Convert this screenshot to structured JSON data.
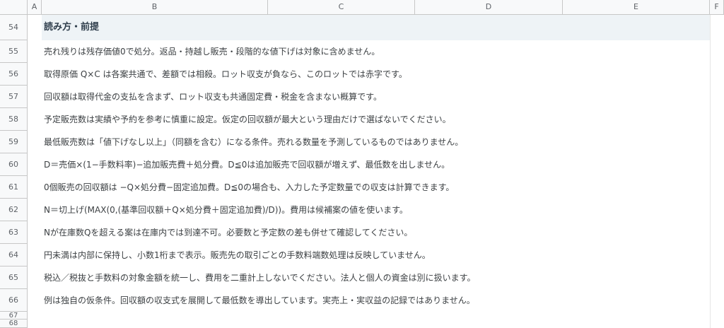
{
  "columns": [
    "A",
    "B",
    "C",
    "D",
    "E",
    "F"
  ],
  "rows": [
    {
      "num": "54",
      "text": "読み方・前提",
      "title": true
    },
    {
      "num": "55",
      "text": "売れ残りは残存価値0で処分。返品・持越し販売・段階的な値下げは対象に含めません。"
    },
    {
      "num": "56",
      "text": "取得原価 Q×C は各案共通で、差額では相殺。ロット収支が負なら、このロットでは赤字です。"
    },
    {
      "num": "57",
      "text": "回収額は取得代金の支払を含まず、ロット収支も共通固定費・税金を含まない概算です。"
    },
    {
      "num": "58",
      "text": "予定販売数は実績や予約を参考に慎重に設定。仮定の回収額が最大という理由だけで選ばないでください。"
    },
    {
      "num": "59",
      "text": "最低販売数は「値下げなし以上」（同額を含む）になる条件。売れる数量を予測しているものではありません。"
    },
    {
      "num": "60",
      "text": "D＝売価×(1−手数料率)−追加販売費＋処分費。D≦0は追加販売で回収額が増えず、最低数を出しません。"
    },
    {
      "num": "61",
      "text": "0個販売の回収額は −Q×処分費−固定追加費。D≦0の場合も、入力した予定数量での収支は計算できます。"
    },
    {
      "num": "62",
      "text": "N＝切上げ(MAX(0,(基準回収額＋Q×処分費＋固定追加費)/D))。費用は候補案の値を使います。"
    },
    {
      "num": "63",
      "text": "Nが在庫数Qを超える案は在庫内では到達不可。必要数と予定数の差も併せて確認してください。"
    },
    {
      "num": "64",
      "text": "円未満は内部に保持し、小数1桁まで表示。販売先の取引ごとの手数料端数処理は反映していません。"
    },
    {
      "num": "65",
      "text": "税込／税抜と手数料の対象金額を統一し、費用を二重計上しないでください。法人と個人の資金は別に扱います。"
    },
    {
      "num": "66",
      "text": "例は独自の仮条件。回収額の収支式を展開して最低数を導出しています。実売上・実収益の記録ではありません。"
    },
    {
      "num": "67",
      "text": ""
    },
    {
      "num": "68",
      "text": ""
    }
  ]
}
